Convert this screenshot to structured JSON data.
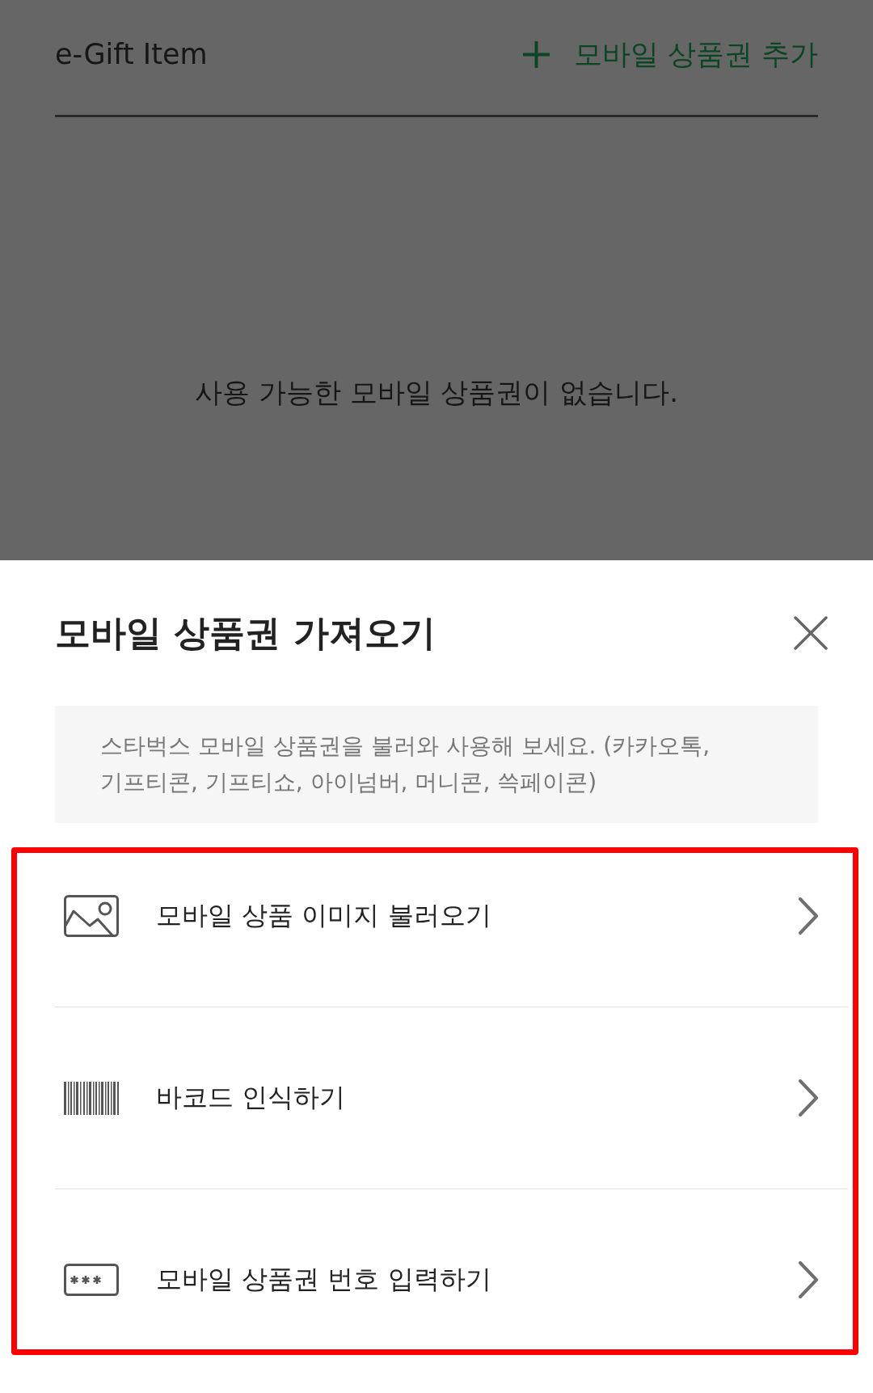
{
  "page": {
    "dimmed": true,
    "title": "e-Gift Item",
    "add_button": {
      "label": "모바일 상품권 추가"
    },
    "empty_message": "사용 가능한 모바일 상품권이 없습니다."
  },
  "sheet": {
    "title": "모바일 상품권 가져오기",
    "notice": "스타벅스 모바일 상품권을 불러와 사용해 보세요. (카카오톡, 기프티콘, 기프티쇼, 아이넘버, 머니콘, 쓱페이콘)",
    "options_highlighted": true,
    "options": [
      {
        "kind": "image",
        "label": "모바일 상품 이미지 불러오기"
      },
      {
        "kind": "barcode",
        "label": "바코드 인식하기"
      },
      {
        "kind": "code",
        "label": "모바일 상품권 번호 입력하기"
      }
    ]
  }
}
